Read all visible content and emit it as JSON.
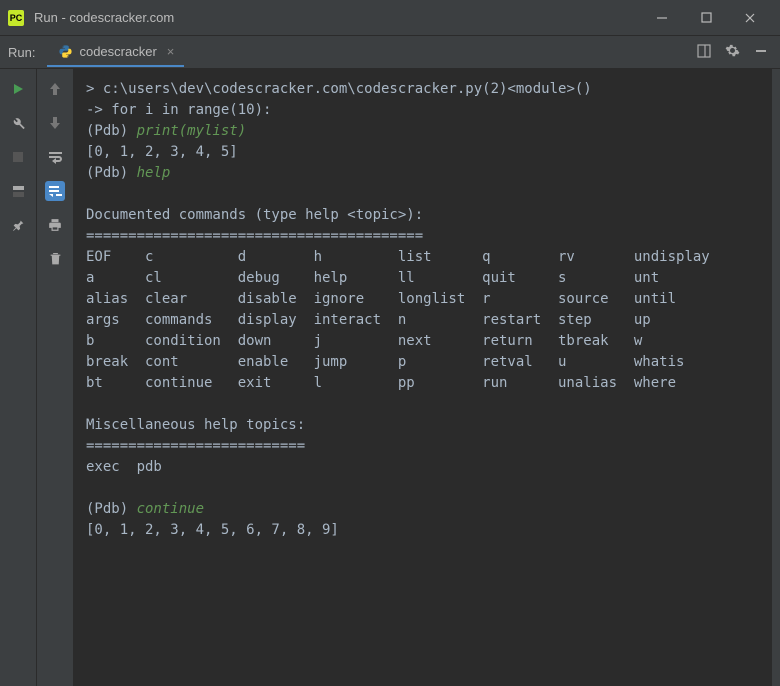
{
  "window": {
    "logo_text": "PC",
    "title": "Run - codescracker.com"
  },
  "tabbar": {
    "label": "Run:",
    "tab_name": "codescracker"
  },
  "console": {
    "line1_pre": "> ",
    "line1": "c:\\users\\dev\\codescracker.com\\codescracker.py(2)<module>()",
    "line2": "-> for i in range(10):",
    "line3_pre": "(Pdb) ",
    "line3_cmd": "print(mylist)",
    "line4": "[0, 1, 2, 3, 4, 5]",
    "line5_pre": "(Pdb) ",
    "line5_cmd": "help",
    "blank": "",
    "doc_header": "Documented commands (type help <topic>):",
    "sep1": "========================================",
    "row1": "EOF    c          d        h         list      q        rv       undisplay",
    "row2": "a      cl         debug    help      ll        quit     s        unt",
    "row3": "alias  clear      disable  ignore    longlist  r        source   until",
    "row4": "args   commands   display  interact  n         restart  step     up",
    "row5": "b      condition  down     j         next      return   tbreak   w",
    "row6": "break  cont       enable   jump      p         retval   u        whatis",
    "row7": "bt     continue   exit     l         pp        run      unalias  where",
    "misc_header": "Miscellaneous help topics:",
    "sep2": "==========================",
    "misc_row": "exec  pdb",
    "line_cont_pre": "(Pdb) ",
    "line_cont_cmd": "continue",
    "line_result": "[0, 1, 2, 3, 4, 5, 6, 7, 8, 9]"
  }
}
